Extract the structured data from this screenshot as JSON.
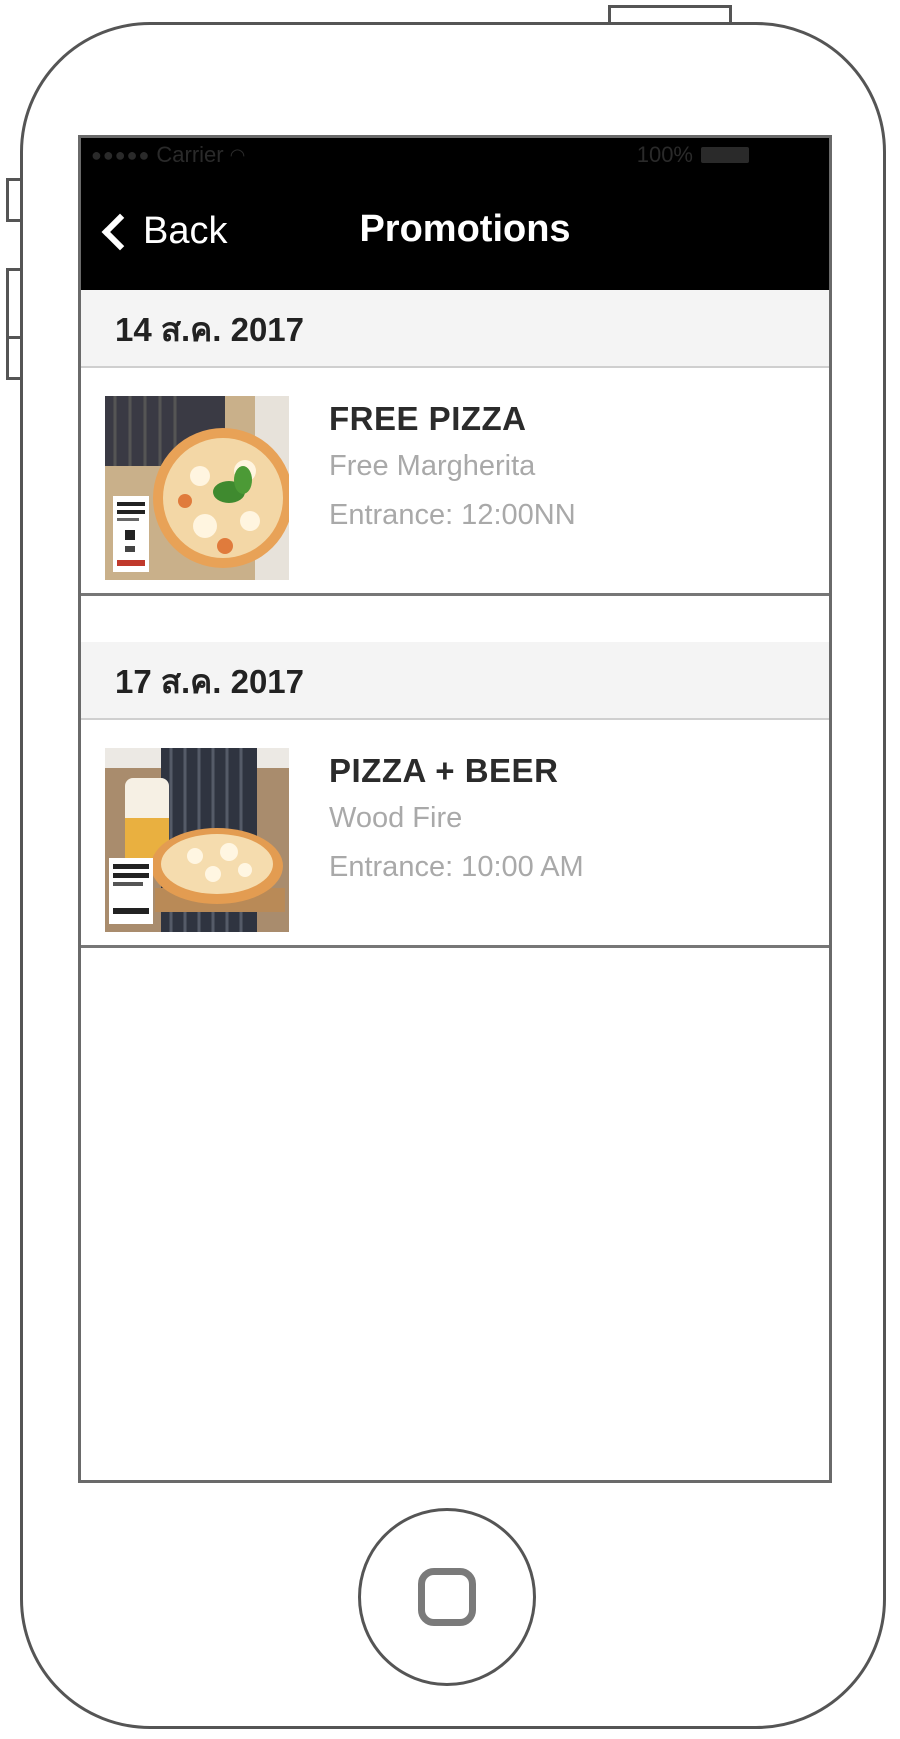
{
  "status_bar": {
    "carrier": "Carrier",
    "battery": "100%",
    "icons": [
      "signal-dots-icon",
      "wifi-icon",
      "battery-icon"
    ]
  },
  "nav": {
    "back_label": "Back",
    "title": "Promotions"
  },
  "sections": [
    {
      "date": "14 ส.ค. 2017",
      "items": [
        {
          "title": "FREE PIZZA",
          "subtitle": "Free Margherita",
          "entrance": "Entrance: 12:00NN",
          "thumbnail": "pizza-margherita-photo"
        }
      ]
    },
    {
      "date": "17 ส.ค. 2017",
      "items": [
        {
          "title": "PIZZA + BEER",
          "subtitle": "Wood Fire",
          "entrance": "Entrance: 10:00 AM",
          "thumbnail": "pizza-beer-photo"
        }
      ]
    }
  ],
  "colors": {
    "nav_background": "#000000",
    "section_header_background": "#f4f4f4",
    "secondary_text": "#a9a9a9",
    "frame_stroke": "#555555"
  }
}
